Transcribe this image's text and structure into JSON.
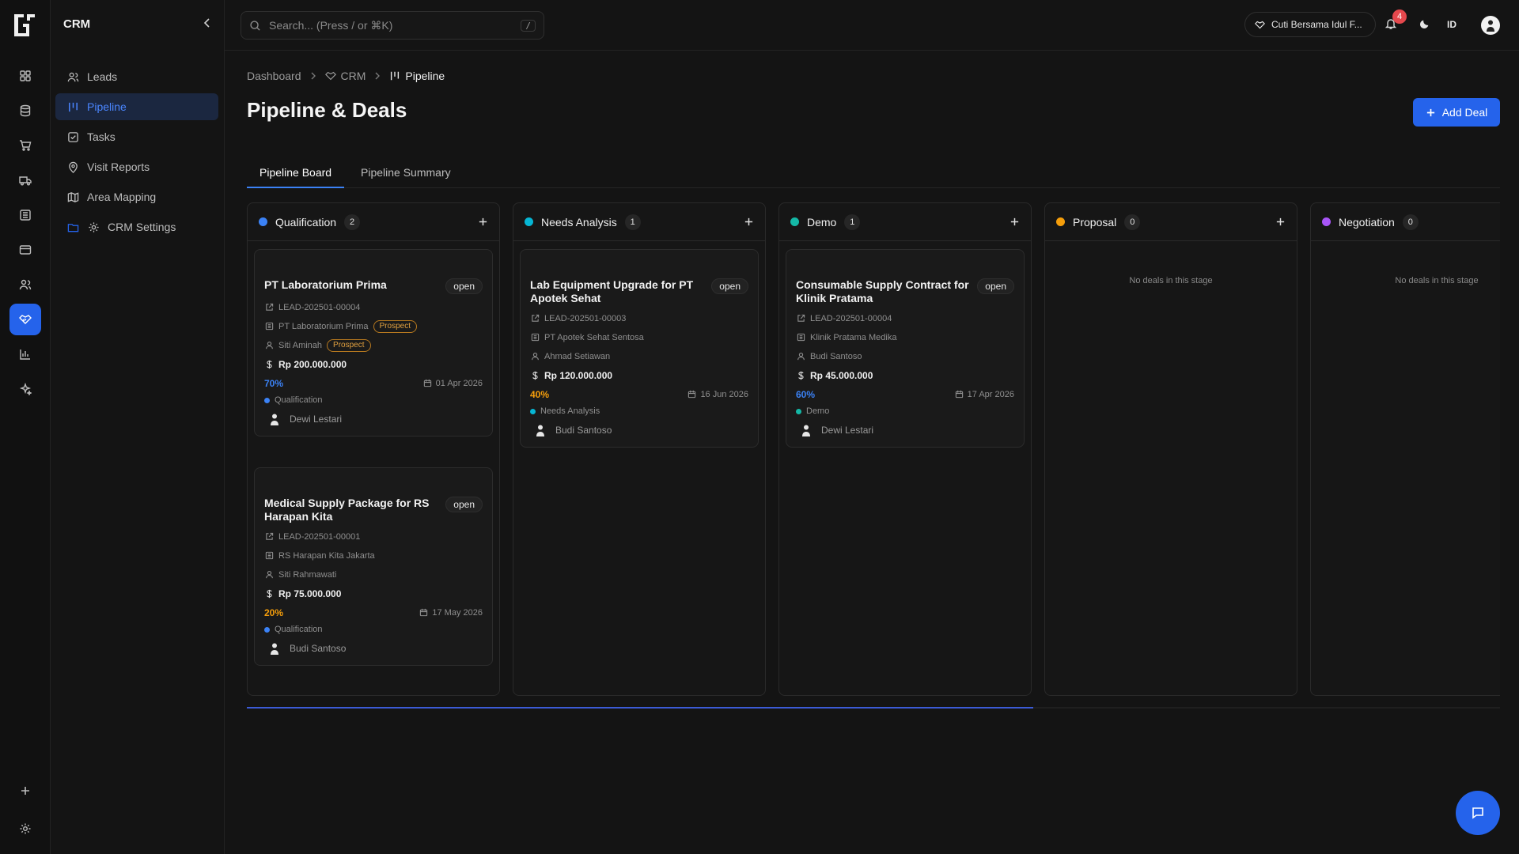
{
  "app": {
    "name": "CRM"
  },
  "rail": {
    "items": [
      {
        "icon": "dashboard-icon"
      },
      {
        "icon": "database-icon"
      },
      {
        "icon": "cart-icon"
      },
      {
        "icon": "truck-icon"
      },
      {
        "icon": "building-icon"
      },
      {
        "icon": "card-icon"
      },
      {
        "icon": "users-icon"
      },
      {
        "icon": "handshake-icon",
        "active": true
      },
      {
        "icon": "bar-chart-icon"
      },
      {
        "icon": "sparkles-icon"
      }
    ],
    "bottom": [
      {
        "icon": "plus-icon"
      },
      {
        "icon": "gear-icon"
      }
    ]
  },
  "sidebar": {
    "items": [
      {
        "label": "Leads",
        "icon": "users-icon"
      },
      {
        "label": "Pipeline",
        "icon": "pipeline-icon",
        "active": true
      },
      {
        "label": "Tasks",
        "icon": "checkbox-icon"
      },
      {
        "label": "Visit Reports",
        "icon": "map-pin-icon"
      },
      {
        "label": "Area Mapping",
        "icon": "map-icon"
      },
      {
        "label": "CRM Settings",
        "icon": "gear-icon"
      }
    ]
  },
  "topbar": {
    "search_placeholder": "Search... (Press / or ⌘K)",
    "search_shortcut": "/",
    "holiday_label": "Cuti Bersama Idul F...",
    "notification_count": "4",
    "language": "ID"
  },
  "breadcrumb": {
    "items": [
      "Dashboard",
      "CRM",
      "Pipeline"
    ]
  },
  "page": {
    "title": "Pipeline & Deals",
    "add_button": "Add Deal"
  },
  "tabs": [
    {
      "label": "Pipeline Board",
      "active": true
    },
    {
      "label": "Pipeline Summary"
    }
  ],
  "colors": {
    "accent": "#2563eb",
    "qualification": "#3b82f6",
    "needs_analysis": "#06b6d4",
    "demo": "#14b8a6",
    "proposal": "#f59e0b",
    "negotiation": "#a855f7",
    "prob_high": "#3b82f6",
    "prob_mid": "#f59e0b"
  },
  "columns": [
    {
      "title": "Qualification",
      "count": "2",
      "cards": [
        {
          "title": "PT Laboratorium Prima",
          "status": "open",
          "lead_id": "LEAD-202501-00004",
          "company": "PT Laboratorium Prima",
          "company_tag": "Prospect",
          "contact": "Siti Aminah",
          "contact_tag": "Prospect",
          "value": "Rp 200.000.000",
          "probability": "70%",
          "date": "01 Apr 2026",
          "stage": "Qualification",
          "owner": "Dewi Lestari"
        },
        {
          "title": "Medical Supply Package for RS Harapan Kita",
          "status": "open",
          "lead_id": "LEAD-202501-00001",
          "company": "RS Harapan Kita Jakarta",
          "contact": "Siti Rahmawati",
          "value": "Rp 75.000.000",
          "probability": "20%",
          "date": "17 May 2026",
          "stage": "Qualification",
          "owner": "Budi Santoso"
        }
      ]
    },
    {
      "title": "Needs Analysis",
      "count": "1",
      "cards": [
        {
          "title": "Lab Equipment Upgrade for PT Apotek Sehat",
          "status": "open",
          "lead_id": "LEAD-202501-00003",
          "company": "PT Apotek Sehat Sentosa",
          "contact": "Ahmad Setiawan",
          "value": "Rp 120.000.000",
          "probability": "40%",
          "date": "16 Jun 2026",
          "stage": "Needs Analysis",
          "owner": "Budi Santoso"
        }
      ]
    },
    {
      "title": "Demo",
      "count": "1",
      "cards": [
        {
          "title": "Consumable Supply Contract for Klinik Pratama",
          "status": "open",
          "lead_id": "LEAD-202501-00004",
          "company": "Klinik Pratama Medika",
          "contact": "Budi Santoso",
          "value": "Rp 45.000.000",
          "probability": "60%",
          "date": "17 Apr 2026",
          "stage": "Demo",
          "owner": "Dewi Lestari"
        }
      ]
    },
    {
      "title": "Proposal",
      "count": "0",
      "empty_text": "No deals in this stage"
    },
    {
      "title": "Negotiation",
      "count": "0",
      "empty_text": "No deals in this stage"
    }
  ]
}
